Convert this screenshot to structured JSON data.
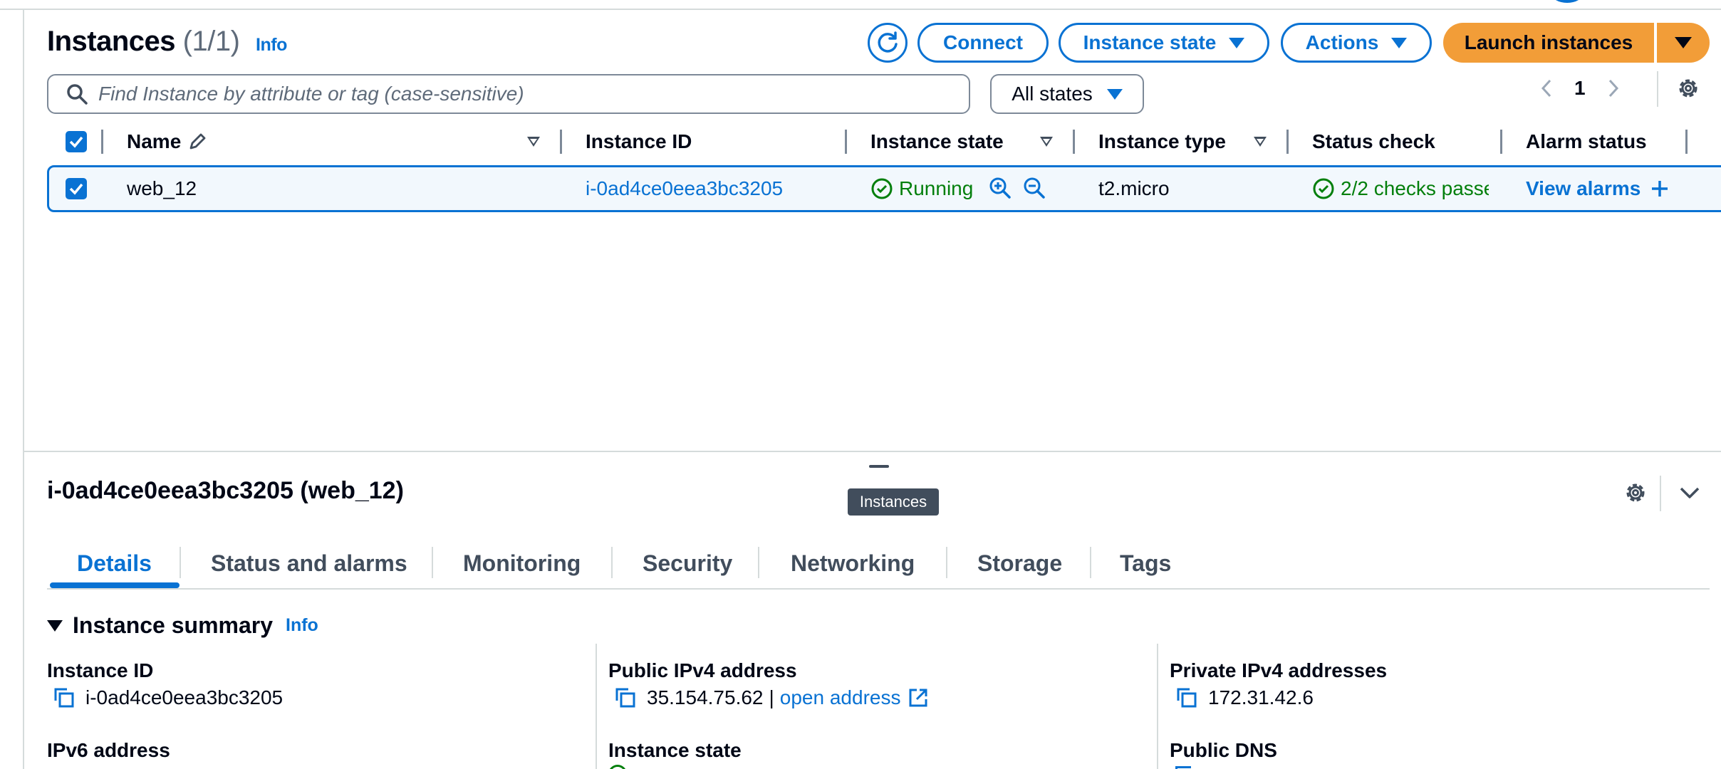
{
  "header": {
    "title": "Instances",
    "count": "(1/1)",
    "info": "Info",
    "connect": "Connect",
    "instance_state": "Instance state",
    "actions": "Actions",
    "launch": "Launch instances"
  },
  "filter": {
    "search_placeholder": "Find Instance by attribute or tag (case-sensitive)",
    "states": "All states",
    "page": "1"
  },
  "table": {
    "columns": {
      "name": "Name",
      "instance_id": "Instance ID",
      "instance_state": "Instance state",
      "instance_type": "Instance type",
      "status_check": "Status check",
      "alarm_status": "Alarm status"
    },
    "rows": [
      {
        "name": "web_12",
        "instance_id": "i-0ad4ce0eea3bc3205",
        "state": "Running",
        "type": "t2.micro",
        "status": "2/2 checks passec",
        "alarms": "View alarms"
      }
    ]
  },
  "details": {
    "title": "i-0ad4ce0eea3bc3205 (web_12)",
    "tooltip": "Instances",
    "tabs": [
      "Details",
      "Status and alarms",
      "Monitoring",
      "Security",
      "Networking",
      "Storage",
      "Tags"
    ],
    "section": "Instance summary",
    "section_info": "Info",
    "fields": {
      "instance_id_label": "Instance ID",
      "instance_id_value": "i-0ad4ce0eea3bc3205",
      "public_ip_label": "Public IPv4 address",
      "public_ip_value": "35.154.75.62",
      "open_address": "open address",
      "private_ip_label": "Private IPv4 addresses",
      "private_ip_value": "172.31.42.6",
      "ipv6_label": "IPv6 address",
      "instance_state_label": "Instance state",
      "public_dns_label": "Public DNS"
    }
  },
  "colors": {
    "link": "#0972d3",
    "accent": "#f29d38",
    "success": "#037f0c"
  }
}
